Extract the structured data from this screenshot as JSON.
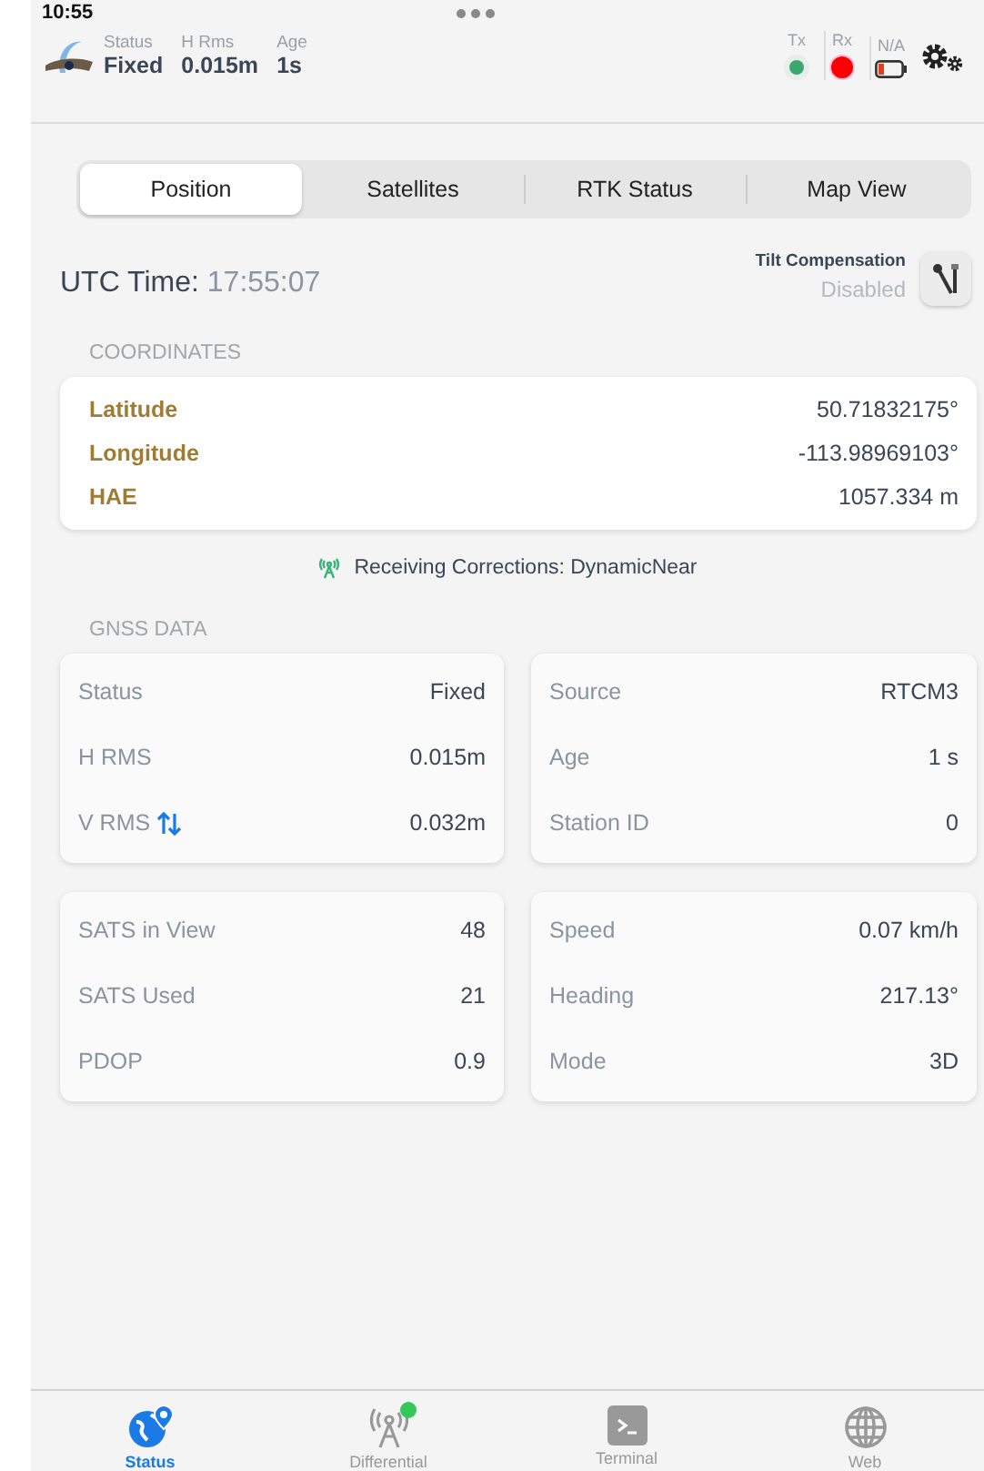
{
  "status_bar": {
    "time": "10:55"
  },
  "header": {
    "stats": [
      {
        "label": "Status",
        "value": "Fixed"
      },
      {
        "label": "H Rms",
        "value": "0.015m"
      },
      {
        "label": "Age",
        "value": "1s"
      }
    ],
    "indicators": [
      {
        "label": "Tx",
        "kind": "dot",
        "color": "#3aa76d"
      },
      {
        "label": "Rx",
        "kind": "dot",
        "color": "#ff0000"
      },
      {
        "label": "N/A",
        "kind": "battery",
        "color": "#e2401c"
      }
    ]
  },
  "tabs": [
    {
      "label": "Position",
      "selected": true
    },
    {
      "label": "Satellites",
      "selected": false
    },
    {
      "label": "RTK Status",
      "selected": false
    },
    {
      "label": "Map View",
      "selected": false
    }
  ],
  "utc": {
    "label": "UTC Time:",
    "value": "17:55:07"
  },
  "tilt": {
    "label": "Tilt Compensation",
    "value": "Disabled"
  },
  "coordinates": {
    "title": "COORDINATES",
    "rows": [
      {
        "label": "Latitude",
        "value": "50.71832175°"
      },
      {
        "label": "Longitude",
        "value": "-113.98969103°"
      },
      {
        "label": "HAE",
        "value": "1057.334 m"
      }
    ]
  },
  "corrections": "Receiving Corrections: DynamicNear",
  "gnss": {
    "title": "GNSS DATA",
    "cards": [
      [
        {
          "label": "Status",
          "value": "Fixed"
        },
        {
          "label": "H RMS",
          "value": "0.015m"
        },
        {
          "label": "V RMS",
          "value": "0.032m",
          "arrows": true
        }
      ],
      [
        {
          "label": "Source",
          "value": "RTCM3"
        },
        {
          "label": "Age",
          "value": "1 s"
        },
        {
          "label": "Station ID",
          "value": "0"
        }
      ],
      [
        {
          "label": "SATS in View",
          "value": "48"
        },
        {
          "label": "SATS Used",
          "value": "21"
        },
        {
          "label": "PDOP",
          "value": "0.9"
        }
      ],
      [
        {
          "label": "Speed",
          "value": "0.07 km/h"
        },
        {
          "label": "Heading",
          "value": "217.13°"
        },
        {
          "label": "Mode",
          "value": "3D"
        }
      ]
    ]
  },
  "bottom_tabs": [
    {
      "label": "Status",
      "kind": "globe-pin",
      "selected": true,
      "badge": false
    },
    {
      "label": "Differential",
      "kind": "antenna",
      "selected": false,
      "badge": true
    },
    {
      "label": "Terminal",
      "kind": "terminal",
      "selected": false,
      "badge": false
    },
    {
      "label": "Web",
      "kind": "globe",
      "selected": false,
      "badge": false
    }
  ]
}
